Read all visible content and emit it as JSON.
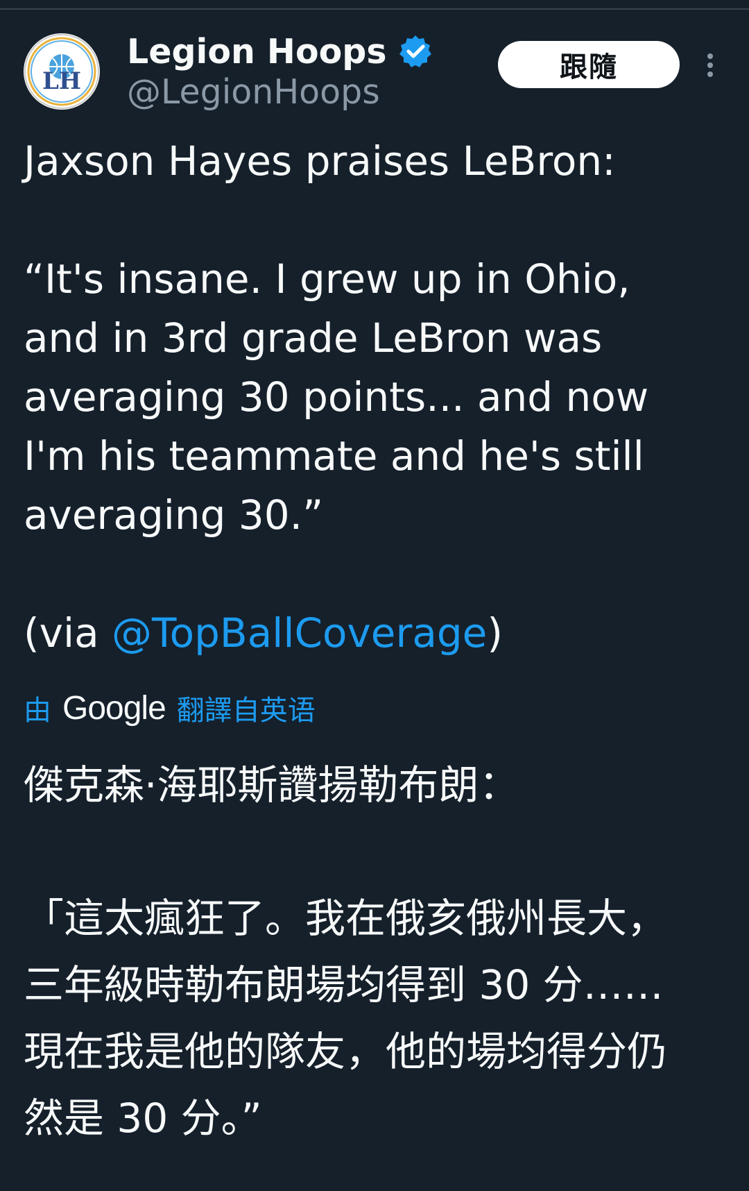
{
  "author": {
    "display_name": "Legion Hoops",
    "handle": "@LegionHoops",
    "avatar_icon": "legion-hoops-logo",
    "verified_icon": "verified-badge-icon",
    "avatar_text": "LH"
  },
  "actions": {
    "follow_label": "跟隨",
    "more_icon": "more-options-icon"
  },
  "tweet": {
    "lines": [
      "Jaxson Hayes praises LeBron:",
      "",
      "“It's insane. I grew up in Ohio,",
      "and in 3rd grade LeBron was",
      "averaging 30 points... and now",
      "I'm his teammate and he's still",
      "averaging 30.”",
      ""
    ],
    "via_prefix": "(via ",
    "via_mention": "@TopBallCoverage",
    "via_suffix": ")"
  },
  "translation": {
    "prefix": "由",
    "provider": "Google",
    "suffix": "翻譯自英语",
    "lines": [
      "傑克森·海耶斯讚揚勒布朗：",
      "",
      "「這太瘋狂了。我在俄亥俄州長大，",
      "三年級時勒布朗場均得到 30 分……",
      "現在我是他的隊友，他的場均得分仍",
      "然是 30 分。”"
    ]
  },
  "colors": {
    "background": "#15202b",
    "text": "#f7f9f9",
    "secondary": "#8b98a5",
    "accent": "#1d9bf0"
  }
}
